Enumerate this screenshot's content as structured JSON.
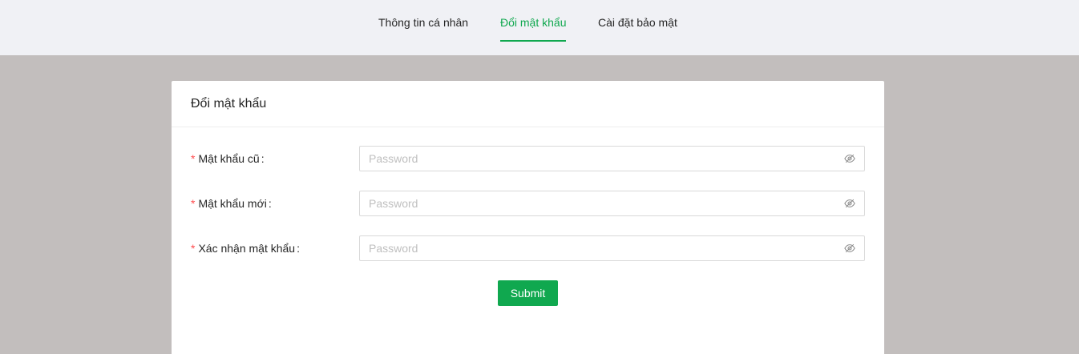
{
  "colors": {
    "accent": "#10a84f",
    "required": "#ff4d4f",
    "page_bg": "#c2bebd",
    "topbar_bg": "#f0f1f5"
  },
  "tabs": [
    {
      "label": "Thông tin cá nhân",
      "active": false
    },
    {
      "label": "Đổi mật khẩu",
      "active": true
    },
    {
      "label": "Cài đặt bảo mật",
      "active": false
    }
  ],
  "card": {
    "title": "Đổi mật khẩu"
  },
  "form": {
    "fields": [
      {
        "required": "*",
        "label": "Mật khẩu cũ",
        "colon": ":",
        "placeholder": "Password",
        "value": "",
        "icon": "eye-invisible-icon"
      },
      {
        "required": "*",
        "label": "Mật khẩu mới",
        "colon": ":",
        "placeholder": "Password",
        "value": "",
        "icon": "eye-invisible-icon"
      },
      {
        "required": "*",
        "label": "Xác nhận mật khẩu",
        "colon": ":",
        "placeholder": "Password",
        "value": "",
        "icon": "eye-invisible-icon"
      }
    ],
    "submit_label": "Submit"
  }
}
